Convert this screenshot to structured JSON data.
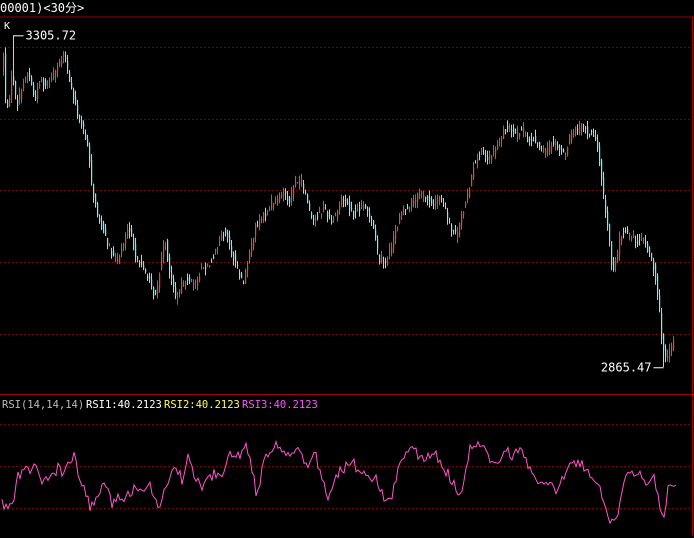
{
  "header": {
    "title": "00001)<30分>"
  },
  "colors": {
    "up": "#ff3b3b",
    "down": "#54ffff",
    "grid": "#7a0000",
    "border": "#a00000",
    "rsi": "#ff55cc",
    "text": "#ffffff",
    "rsi1": "#ffffff",
    "rsi2": "#ffff55",
    "rsi3": "#ff55ff"
  },
  "chart_data": [
    {
      "type": "candlestick",
      "panel_label": "K",
      "ylim": [
        2830,
        3330
      ],
      "gridlines": [
        3290,
        3195,
        3100,
        3005,
        2910
      ],
      "high": {
        "label": "3305.72",
        "value": 3305.72,
        "index": 5
      },
      "low": {
        "label": "2865.47",
        "value": 2865.47,
        "index": 330
      },
      "candle_count": 336,
      "path": [
        [
          0,
          3230
        ],
        [
          5,
          3280
        ],
        [
          8,
          3195
        ],
        [
          14,
          3260
        ],
        [
          18,
          3212
        ],
        [
          24,
          3240
        ],
        [
          30,
          3258
        ],
        [
          36,
          3220
        ],
        [
          42,
          3248
        ],
        [
          48,
          3238
        ],
        [
          54,
          3255
        ],
        [
          60,
          3265
        ],
        [
          66,
          3280
        ],
        [
          72,
          3240
        ],
        [
          78,
          3205
        ],
        [
          84,
          3185
        ],
        [
          90,
          3150
        ],
        [
          94,
          3100
        ],
        [
          100,
          3060
        ],
        [
          106,
          3045
        ],
        [
          112,
          3018
        ],
        [
          118,
          3005
        ],
        [
          124,
          3025
        ],
        [
          130,
          3050
        ],
        [
          136,
          3020
        ],
        [
          142,
          3000
        ],
        [
          148,
          2990
        ],
        [
          154,
          2965
        ],
        [
          158,
          2960
        ],
        [
          162,
          3005
        ],
        [
          166,
          3040
        ],
        [
          170,
          3000
        ],
        [
          174,
          2975
        ],
        [
          178,
          2955
        ],
        [
          184,
          2978
        ],
        [
          190,
          2985
        ],
        [
          196,
          2972
        ],
        [
          202,
          2995
        ],
        [
          208,
          3000
        ],
        [
          214,
          3010
        ],
        [
          220,
          3030
        ],
        [
          226,
          3048
        ],
        [
          232,
          3022
        ],
        [
          238,
          3000
        ],
        [
          244,
          2975
        ],
        [
          250,
          3010
        ],
        [
          256,
          3048
        ],
        [
          262,
          3060
        ],
        [
          268,
          3072
        ],
        [
          274,
          3085
        ],
        [
          280,
          3090
        ],
        [
          286,
          3100
        ],
        [
          290,
          3085
        ],
        [
          296,
          3108
        ],
        [
          302,
          3115
        ],
        [
          308,
          3090
        ],
        [
          314,
          3060
        ],
        [
          320,
          3068
        ],
        [
          326,
          3078
        ],
        [
          332,
          3060
        ],
        [
          338,
          3070
        ],
        [
          344,
          3090
        ],
        [
          350,
          3080
        ],
        [
          356,
          3068
        ],
        [
          362,
          3078
        ],
        [
          368,
          3075
        ],
        [
          374,
          3060
        ],
        [
          380,
          3010
        ],
        [
          386,
          3005
        ],
        [
          392,
          3022
        ],
        [
          398,
          3050
        ],
        [
          404,
          3075
        ],
        [
          410,
          3080
        ],
        [
          416,
          3088
        ],
        [
          422,
          3095
        ],
        [
          428,
          3090
        ],
        [
          434,
          3080
        ],
        [
          440,
          3090
        ],
        [
          446,
          3078
        ],
        [
          452,
          3050
        ],
        [
          458,
          3040
        ],
        [
          464,
          3070
        ],
        [
          470,
          3100
        ],
        [
          476,
          3140
        ],
        [
          482,
          3150
        ],
        [
          488,
          3140
        ],
        [
          494,
          3148
        ],
        [
          500,
          3162
        ],
        [
          506,
          3180
        ],
        [
          512,
          3185
        ],
        [
          518,
          3175
        ],
        [
          524,
          3180
        ],
        [
          530,
          3165
        ],
        [
          536,
          3168
        ],
        [
          542,
          3155
        ],
        [
          548,
          3150
        ],
        [
          554,
          3165
        ],
        [
          560,
          3158
        ],
        [
          566,
          3145
        ],
        [
          572,
          3175
        ],
        [
          578,
          3180
        ],
        [
          584,
          3185
        ],
        [
          590,
          3178
        ],
        [
          596,
          3170
        ],
        [
          600,
          3150
        ],
        [
          604,
          3100
        ],
        [
          610,
          3045
        ],
        [
          614,
          2990
        ],
        [
          618,
          3010
        ],
        [
          622,
          3040
        ],
        [
          626,
          3048
        ],
        [
          632,
          3040
        ],
        [
          638,
          3032
        ],
        [
          644,
          3035
        ],
        [
          650,
          3020
        ],
        [
          656,
          2995
        ],
        [
          660,
          2955
        ],
        [
          664,
          2890
        ],
        [
          668,
          2872
        ],
        [
          672,
          2890
        ],
        [
          676,
          2900
        ]
      ]
    },
    {
      "type": "line",
      "params_label": "RSI(14,14,14)",
      "series": [
        {
          "name": "RSI1",
          "label": "RSI1:40.2123",
          "value": 40.2123
        },
        {
          "name": "RSI2",
          "label": "RSI2:40.2123",
          "value": 40.2123
        },
        {
          "name": "RSI3",
          "label": "RSI3:40.2123",
          "value": 40.2123
        }
      ],
      "ylim": [
        0,
        100
      ],
      "gridlines": [
        80,
        50,
        20
      ],
      "path": [
        [
          0,
          25
        ],
        [
          6,
          20
        ],
        [
          12,
          22
        ],
        [
          18,
          42
        ],
        [
          24,
          48
        ],
        [
          30,
          45
        ],
        [
          34,
          54
        ],
        [
          40,
          38
        ],
        [
          46,
          40
        ],
        [
          52,
          44
        ],
        [
          58,
          48
        ],
        [
          64,
          46
        ],
        [
          70,
          52
        ],
        [
          74,
          56
        ],
        [
          80,
          40
        ],
        [
          86,
          30
        ],
        [
          90,
          20
        ],
        [
          96,
          26
        ],
        [
          102,
          36
        ],
        [
          108,
          30
        ],
        [
          112,
          22
        ],
        [
          118,
          30
        ],
        [
          124,
          26
        ],
        [
          130,
          30
        ],
        [
          136,
          38
        ],
        [
          142,
          32
        ],
        [
          148,
          40
        ],
        [
          154,
          30
        ],
        [
          160,
          20
        ],
        [
          166,
          34
        ],
        [
          172,
          46
        ],
        [
          176,
          52
        ],
        [
          182,
          40
        ],
        [
          186,
          54
        ],
        [
          190,
          56
        ],
        [
          196,
          40
        ],
        [
          202,
          36
        ],
        [
          208,
          40
        ],
        [
          214,
          44
        ],
        [
          220,
          42
        ],
        [
          226,
          50
        ],
        [
          230,
          58
        ],
        [
          236,
          60
        ],
        [
          240,
          54
        ],
        [
          246,
          66
        ],
        [
          250,
          58
        ],
        [
          256,
          30
        ],
        [
          260,
          40
        ],
        [
          266,
          56
        ],
        [
          272,
          62
        ],
        [
          278,
          66
        ],
        [
          284,
          58
        ],
        [
          290,
          60
        ],
        [
          296,
          64
        ],
        [
          302,
          56
        ],
        [
          308,
          48
        ],
        [
          314,
          60
        ],
        [
          320,
          48
        ],
        [
          324,
          36
        ],
        [
          328,
          26
        ],
        [
          334,
          38
        ],
        [
          340,
          46
        ],
        [
          346,
          50
        ],
        [
          352,
          54
        ],
        [
          358,
          46
        ],
        [
          364,
          48
        ],
        [
          370,
          44
        ],
        [
          376,
          40
        ],
        [
          382,
          30
        ],
        [
          386,
          26
        ],
        [
          390,
          24
        ],
        [
          396,
          40
        ],
        [
          400,
          52
        ],
        [
          406,
          62
        ],
        [
          412,
          66
        ],
        [
          418,
          56
        ],
        [
          424,
          54
        ],
        [
          430,
          58
        ],
        [
          436,
          60
        ],
        [
          440,
          52
        ],
        [
          446,
          46
        ],
        [
          452,
          40
        ],
        [
          458,
          28
        ],
        [
          464,
          36
        ],
        [
          470,
          62
        ],
        [
          476,
          66
        ],
        [
          482,
          64
        ],
        [
          488,
          56
        ],
        [
          494,
          50
        ],
        [
          500,
          56
        ],
        [
          506,
          60
        ],
        [
          512,
          58
        ],
        [
          518,
          62
        ],
        [
          524,
          56
        ],
        [
          530,
          46
        ],
        [
          536,
          40
        ],
        [
          542,
          36
        ],
        [
          548,
          38
        ],
        [
          554,
          32
        ],
        [
          560,
          36
        ],
        [
          566,
          48
        ],
        [
          572,
          56
        ],
        [
          578,
          52
        ],
        [
          584,
          50
        ],
        [
          590,
          44
        ],
        [
          596,
          36
        ],
        [
          600,
          32
        ],
        [
          606,
          18
        ],
        [
          612,
          10
        ],
        [
          618,
          16
        ],
        [
          624,
          40
        ],
        [
          630,
          46
        ],
        [
          636,
          40
        ],
        [
          642,
          44
        ],
        [
          648,
          38
        ],
        [
          654,
          40
        ],
        [
          660,
          20
        ],
        [
          664,
          16
        ],
        [
          668,
          32
        ],
        [
          674,
          36
        ]
      ]
    }
  ]
}
